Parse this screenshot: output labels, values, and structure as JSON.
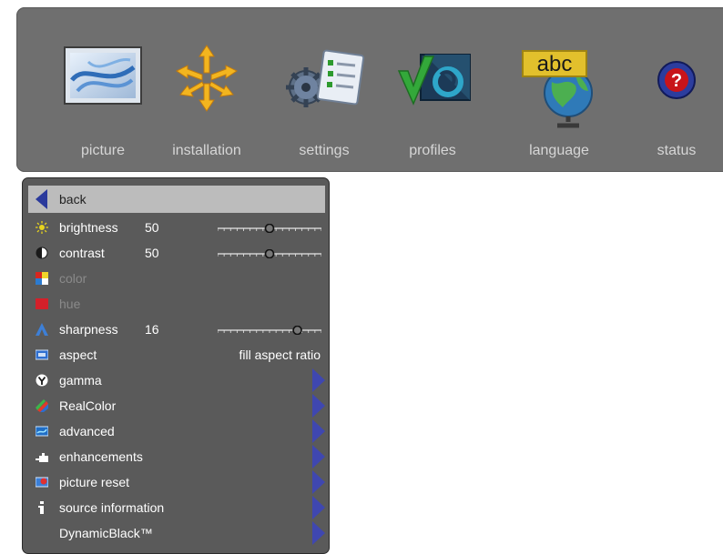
{
  "top_menu": {
    "tabs": [
      {
        "id": "picture",
        "label": "picture",
        "icon": "picture-icon"
      },
      {
        "id": "installation",
        "label": "installation",
        "icon": "installation-icon"
      },
      {
        "id": "settings",
        "label": "settings",
        "icon": "settings-icon"
      },
      {
        "id": "profiles",
        "label": "profiles",
        "icon": "profiles-icon"
      },
      {
        "id": "language",
        "label": "language",
        "icon": "language-icon"
      },
      {
        "id": "status",
        "label": "status",
        "icon": "status-icon"
      }
    ],
    "language_icon_text": "abc",
    "status_icon_text": "?"
  },
  "picture_menu": {
    "back": {
      "label": "back",
      "icon": "back-arrow-icon"
    },
    "items": [
      {
        "label": "brightness",
        "value": "50",
        "slider_fraction": 0.5,
        "icon": "sun-icon"
      },
      {
        "label": "contrast",
        "value": "50",
        "slider_fraction": 0.5,
        "icon": "contrast-icon"
      },
      {
        "label": "color",
        "disabled": true,
        "icon": "color-icon"
      },
      {
        "label": "hue",
        "disabled": true,
        "icon": "hue-icon"
      },
      {
        "label": "sharpness",
        "value": "16",
        "slider_fraction": 0.8,
        "icon": "sharpness-icon"
      },
      {
        "label": "aspect",
        "value": "fill aspect ratio",
        "icon": "aspect-icon"
      },
      {
        "label": "gamma",
        "submenu": true,
        "icon": "gamma-icon"
      },
      {
        "label": "RealColor",
        "submenu": true,
        "icon": "realcolor-icon"
      },
      {
        "label": "advanced",
        "submenu": true,
        "icon": "advanced-icon"
      },
      {
        "label": "enhancements",
        "submenu": true,
        "icon": "enhancements-icon"
      },
      {
        "label": "picture reset",
        "submenu": true,
        "icon": "picture-reset-icon"
      },
      {
        "label": "source information",
        "submenu": true,
        "icon": "info-icon"
      },
      {
        "label": "DynamicBlack™",
        "submenu": true
      }
    ]
  }
}
